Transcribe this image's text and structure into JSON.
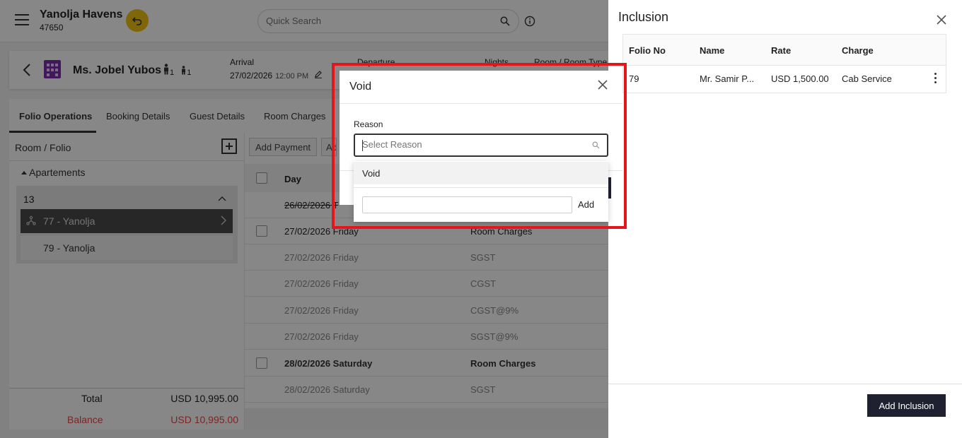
{
  "header": {
    "hotel_name": "Yanolja Havens",
    "hotel_id": "47650",
    "search_placeholder": "Quick Search"
  },
  "guest": {
    "name": "Ms. Jobel Yubos",
    "adults": "1",
    "children": "1",
    "arrival_label": "Arrival",
    "arrival_date": "27/02/2026",
    "arrival_time": "12:00 PM",
    "departure_label": "Departure",
    "nights_label": "Nights",
    "room_label": "Room / Room Type"
  },
  "tabs": [
    "Folio Operations",
    "Booking Details",
    "Guest Details",
    "Room Charges"
  ],
  "left_panel": {
    "header": "Room / Folio",
    "group": "Apartements",
    "room_number": "13",
    "folios": [
      "77 - Yanolja",
      "79 - Yanolja"
    ],
    "total_label": "Total",
    "total_value": "USD 10,995.00",
    "balance_label": "Balance",
    "balance_value": "USD 10,995.00"
  },
  "right_panel": {
    "add_payment": "Add Payment",
    "second_button": "Ad",
    "day_header": "Day",
    "rows": [
      {
        "day": "26/02/2026 T",
        "charge": ""
      },
      {
        "day": "27/02/2026 Friday",
        "charge": "Room Charges"
      },
      {
        "day": "27/02/2026 Friday",
        "charge": "SGST"
      },
      {
        "day": "27/02/2026 Friday",
        "charge": "CGST"
      },
      {
        "day": "27/02/2026 Friday",
        "charge": "CGST@9%"
      },
      {
        "day": "27/02/2026 Friday",
        "charge": "SGST@9%"
      },
      {
        "day": "28/02/2026 Saturday",
        "charge": "Room Charges"
      },
      {
        "day": "28/02/2026 Saturday",
        "charge": "SGST"
      }
    ]
  },
  "drawer": {
    "title": "Inclusion",
    "columns": [
      "Folio No",
      "Name",
      "Rate",
      "Charge"
    ],
    "rows": [
      {
        "folio": "79",
        "name": "Mr. Samir P...",
        "rate": "USD 1,500.00",
        "charge": "Cab Service"
      }
    ],
    "add_button": "Add Inclusion"
  },
  "dialog": {
    "title": "Void",
    "reason_label": "Reason",
    "reason_placeholder": "Select Reason",
    "options": [
      "Void"
    ],
    "add_label": "Add"
  },
  "colors": {
    "highlight": "#e5161b",
    "accent_yellow": "#f0c010",
    "dark_button": "#1f2130",
    "balance_red": "#e44444",
    "hotel_icon_purple": "#7d2db2"
  }
}
